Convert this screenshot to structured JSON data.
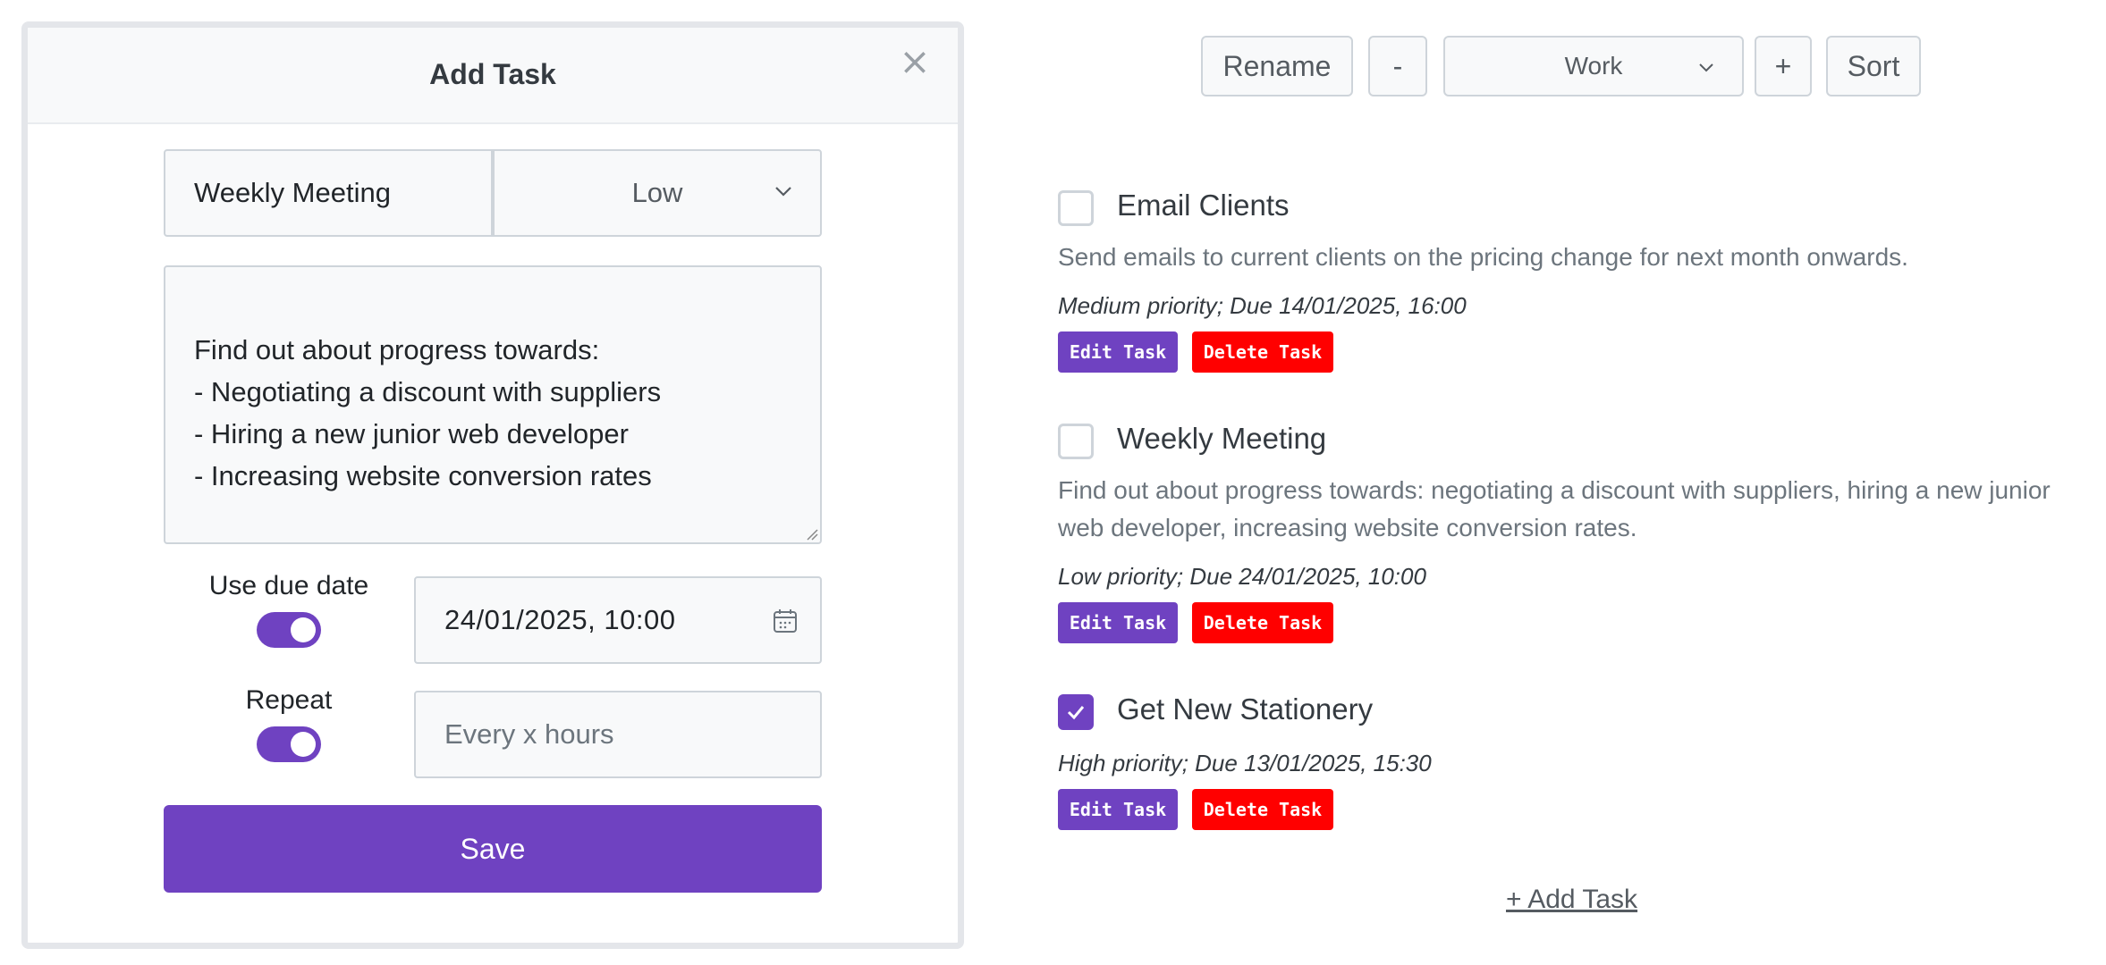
{
  "modal": {
    "title": "Add Task",
    "close_glyph": "×",
    "task_title_value": "Weekly Meeting",
    "priority_value": "Low",
    "description_value": "Find out about progress towards:\n- Negotiating a discount with suppliers\n- Hiring a new junior web developer\n- Increasing website conversion rates",
    "due_date_toggle_label": "Use due date",
    "due_date_toggle_on": true,
    "due_date_value": "24/01/2025, 10:00",
    "repeat_toggle_label": "Repeat",
    "repeat_toggle_on": true,
    "repeat_placeholder": "Every x hours",
    "save_label": "Save"
  },
  "toolbar": {
    "rename_label": "Rename",
    "remove_list_label": "-",
    "list_select_value": "Work",
    "add_list_label": "+",
    "sort_label": "Sort"
  },
  "tasks": [
    {
      "title": "Email Clients",
      "checked": false,
      "description": "Send emails to current clients on the pricing change for next month onwards.",
      "meta": "Medium priority; Due 14/01/2025, 16:00",
      "edit_label": "Edit Task",
      "delete_label": "Delete Task"
    },
    {
      "title": "Weekly Meeting",
      "checked": false,
      "description": "Find out about progress towards: negotiating a discount with suppliers, hiring a new junior web developer, increasing website conversion rates.",
      "meta": "Low priority; Due 24/01/2025, 10:00",
      "edit_label": "Edit Task",
      "delete_label": "Delete Task"
    },
    {
      "title": "Get New Stationery",
      "checked": true,
      "description": "",
      "meta": "High priority; Due 13/01/2025, 15:30",
      "edit_label": "Edit Task",
      "delete_label": "Delete Task"
    }
  ],
  "add_task_label": "+ Add Task",
  "colors": {
    "accent": "#6f42c1",
    "danger": "#ff0000",
    "muted": "#6c757d"
  },
  "icons": {
    "close": "close-icon",
    "chevron": "chevron-down-icon",
    "calendar": "calendar-icon",
    "check": "check-icon"
  }
}
